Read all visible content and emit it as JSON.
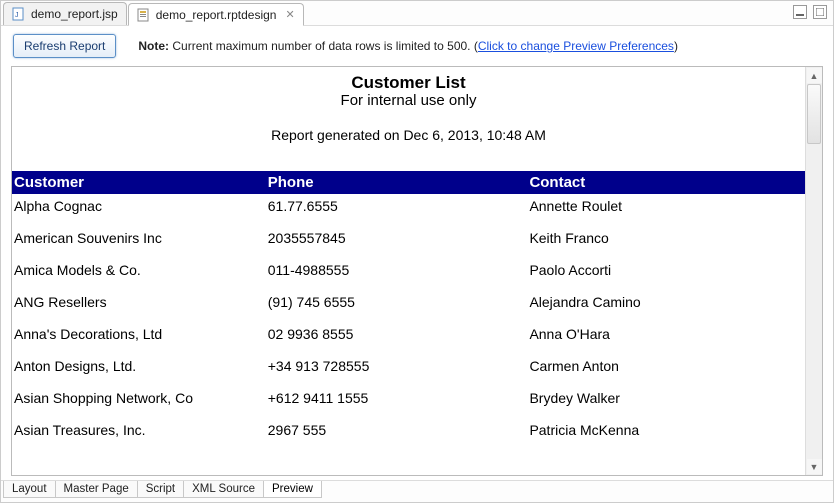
{
  "tabs_top": [
    {
      "label": "demo_report.jsp",
      "active": false,
      "icon": "jsp"
    },
    {
      "label": "demo_report.rptdesign",
      "active": true,
      "icon": "rpt"
    }
  ],
  "toolbar": {
    "refresh_label": "Refresh Report",
    "note_prefix": "Note:",
    "note_text": "Current maximum number of data rows is limited to 500. (",
    "note_link": "Click to change Preview Preferences",
    "note_suffix": ")"
  },
  "report": {
    "title": "Customer List",
    "subtitle": "For internal use only",
    "generated": "Report generated on Dec 6, 2013, 10:48 AM",
    "columns": [
      "Customer",
      "Phone",
      "Contact"
    ],
    "rows": [
      {
        "customer": "Alpha Cognac",
        "phone": "61.77.6555",
        "contact": "Annette  Roulet"
      },
      {
        "customer": "American Souvenirs Inc",
        "phone": "2035557845",
        "contact": "Keith Franco"
      },
      {
        "customer": "Amica Models & Co.",
        "phone": "011-4988555",
        "contact": "Paolo  Accorti"
      },
      {
        "customer": "ANG Resellers",
        "phone": "(91) 745 6555",
        "contact": "Alejandra  Camino"
      },
      {
        "customer": "Anna's Decorations, Ltd",
        "phone": "02 9936 8555",
        "contact": "Anna O'Hara"
      },
      {
        "customer": "Anton Designs, Ltd.",
        "phone": "+34 913 728555",
        "contact": "Carmen Anton"
      },
      {
        "customer": "Asian Shopping Network, Co",
        "phone": "+612 9411 1555",
        "contact": "Brydey Walker"
      },
      {
        "customer": "Asian Treasures, Inc.",
        "phone": "2967 555",
        "contact": "Patricia  McKenna"
      }
    ]
  },
  "tabs_bottom": [
    {
      "label": "Layout",
      "active": false
    },
    {
      "label": "Master Page",
      "active": false
    },
    {
      "label": "Script",
      "active": false
    },
    {
      "label": "XML Source",
      "active": false
    },
    {
      "label": "Preview",
      "active": true
    }
  ]
}
